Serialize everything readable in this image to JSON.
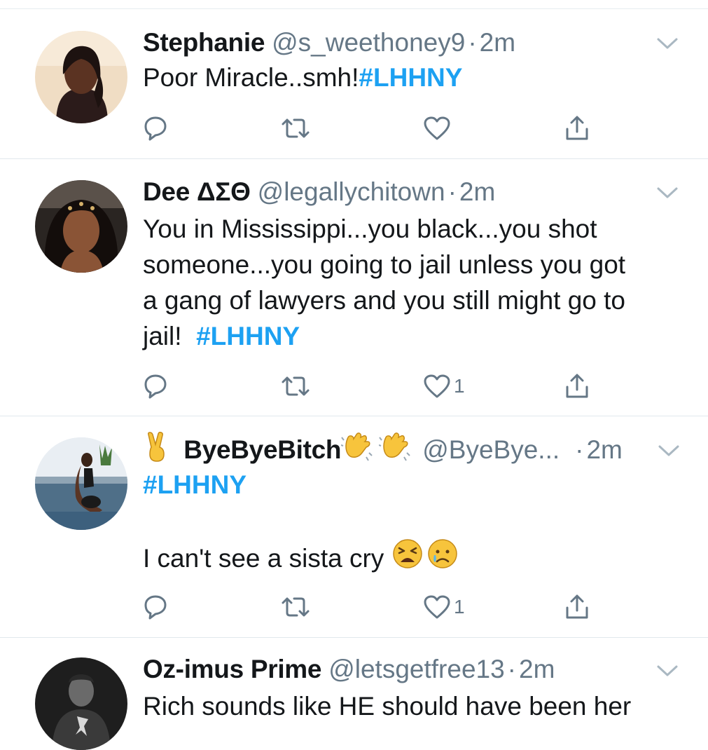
{
  "tweets": [
    {
      "name": "Stephanie",
      "handle": "@s_weethoney9",
      "time": "2m",
      "text": "Poor Miracle..smh!",
      "hashtag": "#LHHNY",
      "like_count": ""
    },
    {
      "name": "Dee ΔΣΘ",
      "handle": "@legallychitown",
      "time": "2m",
      "text_lines": [
        "You in Mississippi...you black...you shot",
        "someone...you going to jail unless you got",
        "a gang of lawyers and you still might go to"
      ],
      "text_last": "jail!  ",
      "hashtag": "#LHHNY",
      "like_count": "1"
    },
    {
      "name": "ByeByeBitch",
      "handle": "@ByeBye...",
      "time": "2m",
      "hashtag": "#LHHNY",
      "text": "I can't see a sista cry",
      "like_count": "1"
    },
    {
      "name": "Oz-imus Prime",
      "handle": "@letsgetfree13",
      "time": "2m",
      "text": "Rich sounds like HE should have been her"
    }
  ],
  "separator": "·",
  "icons": {
    "reply": "reply-icon",
    "retweet": "retweet-icon",
    "like": "heart-icon",
    "share": "share-icon",
    "more": "chevron-down-icon"
  },
  "colors": {
    "text": "#14171a",
    "secondary": "#657786",
    "hashtag": "#1da1f2",
    "icon": "#657786",
    "divider": "#e1e8ed"
  }
}
